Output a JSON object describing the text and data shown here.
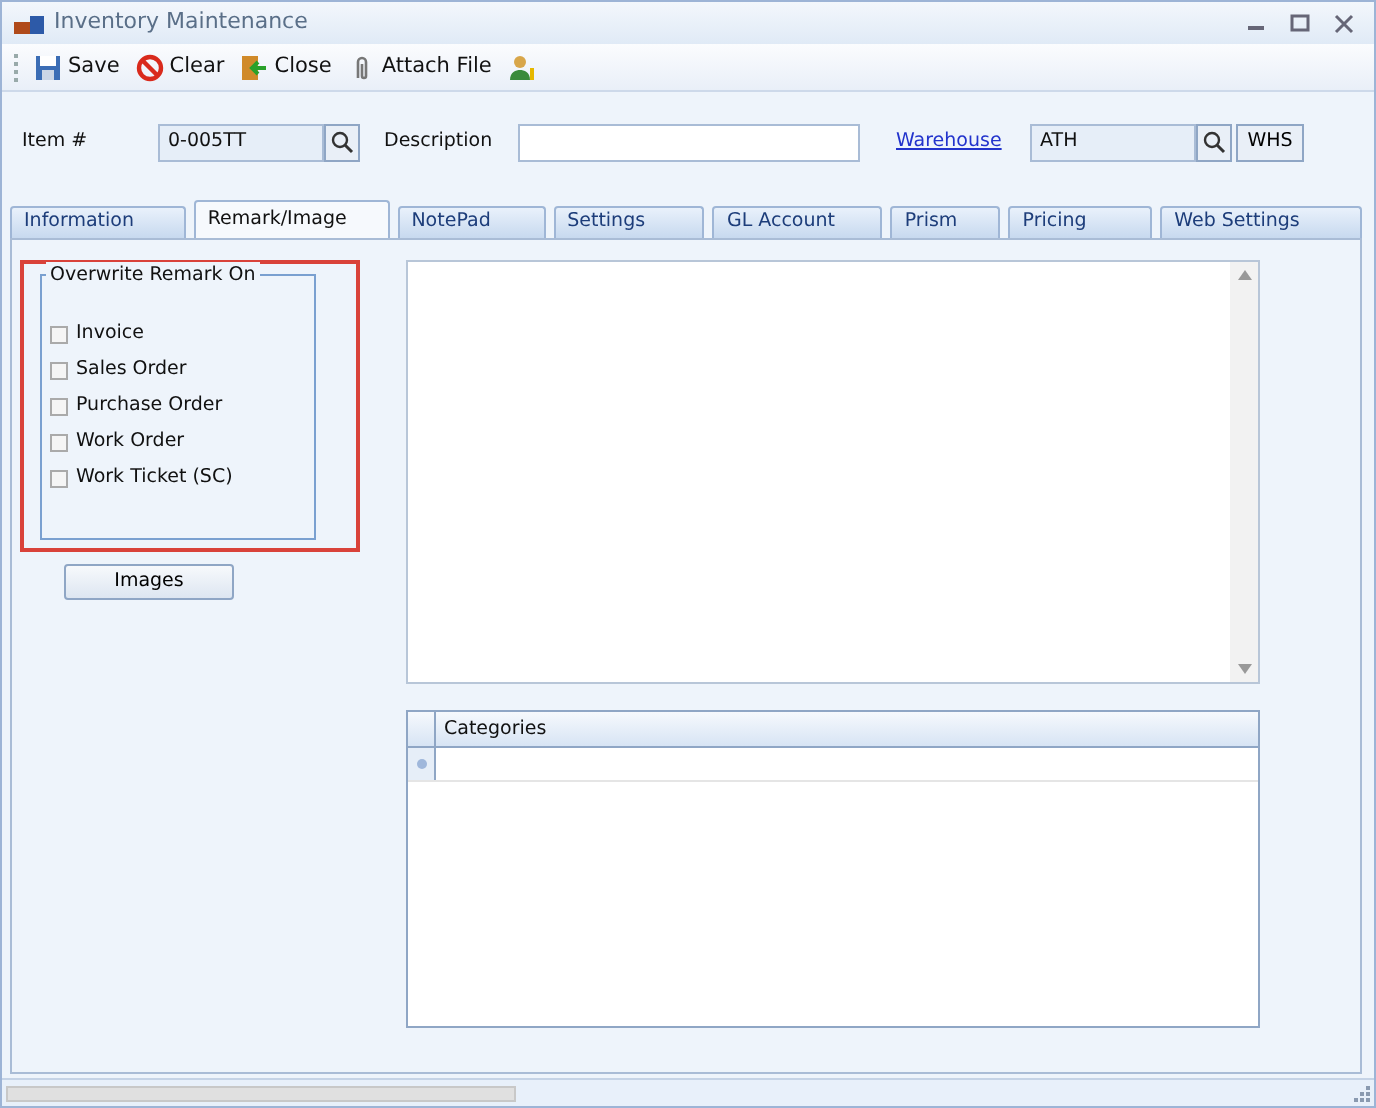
{
  "window": {
    "title": "Inventory Maintenance"
  },
  "toolbar": [
    {
      "label": "Save",
      "kind": "save"
    },
    {
      "label": "Clear",
      "kind": "clear"
    },
    {
      "label": "Close",
      "kind": "close"
    },
    {
      "label": "Attach File",
      "kind": "attach"
    },
    {
      "kind": "user"
    }
  ],
  "header": {
    "item_label": "Item #",
    "item_value": "0-005TT",
    "description_label": "Description",
    "warehouse_link": "Warehouse",
    "warehouse_value": "ATH",
    "whs_button": "WHS"
  },
  "tabs": [
    {
      "label": "Information",
      "selected": false
    },
    {
      "label": "Remark/Image",
      "selected": true
    },
    {
      "label": "NotePad",
      "selected": false
    },
    {
      "label": "Settings",
      "selected": false
    },
    {
      "label": "GL Account",
      "selected": false
    },
    {
      "label": "Prism",
      "selected": false
    },
    {
      "label": "Pricing",
      "selected": false
    },
    {
      "label": "Web Settings",
      "selected": false
    }
  ],
  "overwrite_group": {
    "title": "Overwrite Remark On",
    "options": [
      {
        "label": "Invoice",
        "checked": false
      },
      {
        "label": "Sales Order",
        "checked": false
      },
      {
        "label": "Purchase Order",
        "checked": false
      },
      {
        "label": "Work Order",
        "checked": false
      },
      {
        "label": "Work Ticket (SC)",
        "checked": false
      }
    ]
  },
  "images_button": "Images",
  "categories_grid": {
    "columns": [
      "Categories"
    ]
  }
}
